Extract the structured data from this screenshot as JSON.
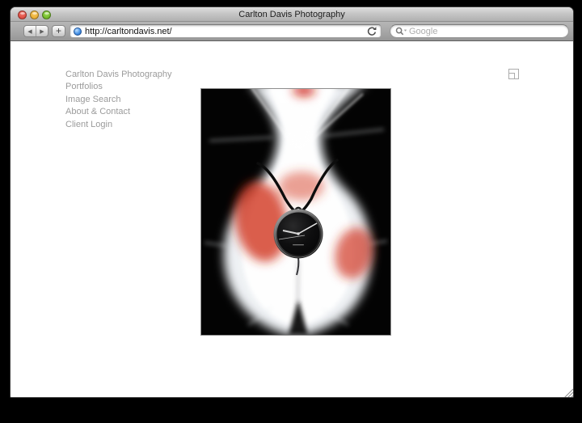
{
  "window": {
    "title": "Carlton Davis Photography",
    "traffic_lights": [
      "close",
      "minimize",
      "zoom"
    ]
  },
  "toolbar": {
    "back_glyph": "◀",
    "forward_glyph": "▶",
    "add_glyph": "+",
    "address": {
      "url": "http://carltondavis.net/"
    },
    "search": {
      "placeholder": "Google"
    }
  },
  "page": {
    "nav": [
      {
        "label": "Carlton Davis Photography"
      },
      {
        "label": "Portfolios"
      },
      {
        "label": "Image Search"
      },
      {
        "label": "About & Contact"
      },
      {
        "label": "Client Login"
      }
    ],
    "photo_alt": "White furry figure with red markings wearing a black cord watch pendant on a black background"
  },
  "colors": {
    "nav_text": "#9b9b9b",
    "chrome_top": "#dedede",
    "chrome_bottom": "#979797",
    "photo_red": "#cf2f1b",
    "background": "#000000"
  }
}
